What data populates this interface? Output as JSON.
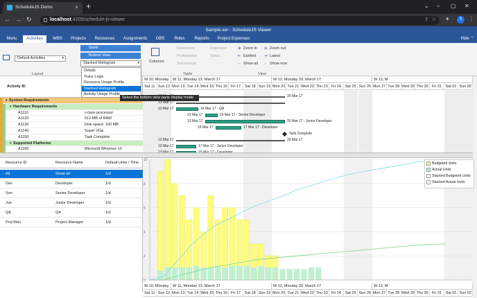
{
  "browser": {
    "tab_title": "ScheduleJS Demo",
    "tab_close": "×",
    "new_tab": "+",
    "url_host": "localhost",
    "url_path": ":4200/schedule-js-viewer",
    "profile_initial": "S",
    "nav": {
      "back": "←",
      "forward": "→",
      "reload": "↻"
    },
    "window": {
      "dropdown": "⌄",
      "minimize": "–",
      "maximize": "▢",
      "close": "✕"
    },
    "tools": {
      "share": "⇪",
      "star": "☆",
      "ext": "✦",
      "menu": "⋮"
    }
  },
  "app": {
    "title": "Sample.xer - ScheduleJS Viewer",
    "hide_label": "Hide ⌃"
  },
  "menu": [
    "Menu",
    "Activities",
    "WBS",
    "Projects",
    "Resources",
    "Assignments",
    "OBS",
    "Roles",
    "Reports",
    "Project Expenses"
  ],
  "ribbon": {
    "layout_combo": "Default Activities",
    "layout_group": "Layout",
    "gantt_btn": "Gantt",
    "bottom_view_btn": "Bottom View",
    "bottom_combo": "Stacked Histogram",
    "table_group": "Table",
    "columns_btn": "Columns",
    "resources_btn": "Resources",
    "professions_btn": "Professions",
    "successors_btn": "Successors",
    "expenses_btn": "Expenses",
    "steps_btn": "Steps",
    "view_group": "View",
    "zoom_in": "Zoom in",
    "zoom_out": "Zoom out",
    "earliest": "Earliest",
    "latest": "Latest",
    "show_all": "Show all",
    "show_now": "Show now"
  },
  "dropdown": [
    "Details",
    "Trace Logic",
    "Resource Usage Profile",
    "Stacked Histogram",
    "Activity Usage Profile"
  ],
  "tooltip": "Select the bottom view pane display mode",
  "activities": {
    "header": "Activity ID",
    "rows": [
      {
        "id": "System Requirements",
        "name": "",
        "level": 0
      },
      {
        "id": "Hardware Requirements",
        "name": "",
        "level": 1
      },
      {
        "id": "A1110",
        "name": "i-class processor",
        "level": 2
      },
      {
        "id": "A1120",
        "name": "512 MB of RAM",
        "level": 2
      },
      {
        "id": "A1130",
        "name": "Disk space: 100 MB",
        "level": 2
      },
      {
        "id": "A1140",
        "name": "Super VGa",
        "level": 2
      },
      {
        "id": "A1150",
        "name": "Task Complete",
        "level": 2
      },
      {
        "id": "Supported Platforms",
        "name": "",
        "level": 1
      },
      {
        "id": "A1160",
        "name": "Microsoft Windows 10",
        "level": 2
      },
      {
        "id": "A1170",
        "name": "Microsoft Windows 8.1",
        "level": 2
      }
    ]
  },
  "timeline": {
    "weeks": [
      "W 10, Monday 6",
      "W 11, Monday 13. March 17",
      "W 12, Monday 20. March 17",
      "W 13, M"
    ],
    "days": [
      "Sat 11",
      "Sun 12",
      "Mon 13",
      "Tue 14",
      "Wed 15",
      "Thu 16",
      "Fri 17",
      "Sat 18",
      "Sun 19",
      "Mon 20",
      "Tue 21",
      "Wed 22",
      "Thu 23",
      "Fri 24",
      "Sat 25",
      "Sun 26",
      "Mon 27",
      "Tue 28",
      "Wed 29",
      "Thu 30",
      "Fri 31",
      "Sat 01",
      "Sun 02"
    ]
  },
  "gantt_labels": [
    "13 Mar 17",
    "20 Mar 17",
    "13 Mar 17",
    "14 Mar 17 - QA",
    "13 Mar 17",
    "15 Mar 17 - Senior Developer",
    "13 Mar 17",
    "20 Mar 17 - Junior Developer",
    "16 Mar 17",
    "17 Mar 17 - Developer",
    "Task Complete",
    "13 Mar 17",
    "20 Mar 17",
    "13 Mar 17",
    "17 Mar 17 - Junior Developer",
    "13 Mar 17",
    "15 Mar 17 - Developer"
  ],
  "resources": {
    "headers": [
      "Resource ID",
      "Resource Name",
      "Default Units / Time"
    ],
    "rows": [
      {
        "id": "All",
        "name": "Show all",
        "units": "1/d"
      },
      {
        "id": "Dev",
        "name": "Developer",
        "units": "1/d"
      },
      {
        "id": "Son",
        "name": "Senior Developer",
        "units": "1/d"
      },
      {
        "id": "Jun",
        "name": "Junior Developer",
        "units": "1/d"
      },
      {
        "id": "QA",
        "name": "QA",
        "units": "1/d"
      },
      {
        "id": "Proj Man",
        "name": "Project Manager",
        "units": "1/d"
      }
    ]
  },
  "legend": {
    "items": [
      {
        "label": "Budgeted Units",
        "color": "#fdfd7a"
      },
      {
        "label": "Actual Units",
        "color": "#bff0d2"
      },
      {
        "label": "Stacked Budgeted Units",
        "color": "#ffffff"
      },
      {
        "label": "Stacked Actual Units",
        "color": "#ffffff"
      }
    ]
  },
  "chart_data": {
    "type": "bar",
    "ylim": [
      0,
      10
    ],
    "yticks": [
      "10",
      "8",
      "6",
      "4",
      "2",
      "0"
    ],
    "x_days": [
      "Sat 11",
      "Sun 12",
      "Mon 13",
      "Tue 14",
      "Wed 15",
      "Thu 16",
      "Fri 17",
      "Sat 18",
      "Sun 19",
      "Mon 20",
      "Tue 21",
      "Wed 22",
      "Thu 23",
      "Fri 24",
      "Sat 25",
      "Sun 26",
      "Mon 27",
      "Tue 28",
      "Wed 29",
      "Thu 30",
      "Fri 31",
      "Sat 01",
      "Sun 02"
    ],
    "series": [
      {
        "name": "Budgeted Units",
        "values": [
          0,
          9,
          10,
          8,
          7,
          5,
          6,
          4,
          7,
          5,
          6,
          6,
          5,
          5,
          3,
          3,
          2,
          2,
          0,
          0,
          0,
          0,
          0,
          0,
          0,
          0,
          0,
          0,
          0,
          0,
          0,
          0,
          0,
          0,
          0,
          0,
          0,
          0,
          0,
          0,
          0,
          0,
          0,
          0,
          0,
          0
        ]
      },
      {
        "name": "Actual Units",
        "values": [
          0,
          0.6,
          0.8,
          0.8,
          0.8,
          0.8,
          0.9,
          0.8,
          0.8,
          0.9,
          0.8,
          0.9,
          0.9,
          0.9,
          0.8,
          0.9,
          0.8,
          0.8,
          0.7,
          0.7,
          0.7,
          0.7,
          0.8,
          0.8,
          0,
          0,
          0,
          0,
          0,
          0,
          0,
          0,
          0,
          0,
          0,
          0,
          0,
          0,
          0,
          0,
          0,
          0,
          0,
          0,
          0,
          0
        ]
      },
      {
        "name": "Stacked Budgeted Units",
        "values": [
          0,
          0.3,
          1.5,
          2.8,
          3.8,
          4.6,
          5.1,
          5.7,
          6.2,
          6.6,
          7.0,
          7.5,
          7.8,
          8.2,
          8.5,
          8.8,
          9.0,
          9.2,
          9.4,
          9.6,
          9.8,
          9.9,
          10
        ]
      },
      {
        "name": "Stacked Actual Units",
        "values": [
          0,
          0,
          0.3,
          0.6,
          0.9,
          1.1,
          1.3,
          1.5,
          1.7,
          1.8,
          1.9,
          2.0,
          2.1,
          2.2,
          2.3,
          2.4,
          2.5,
          2.6,
          2.7,
          2.8,
          2.9,
          2.95,
          3.0
        ]
      }
    ],
    "grid": true,
    "legend": "top-right"
  }
}
